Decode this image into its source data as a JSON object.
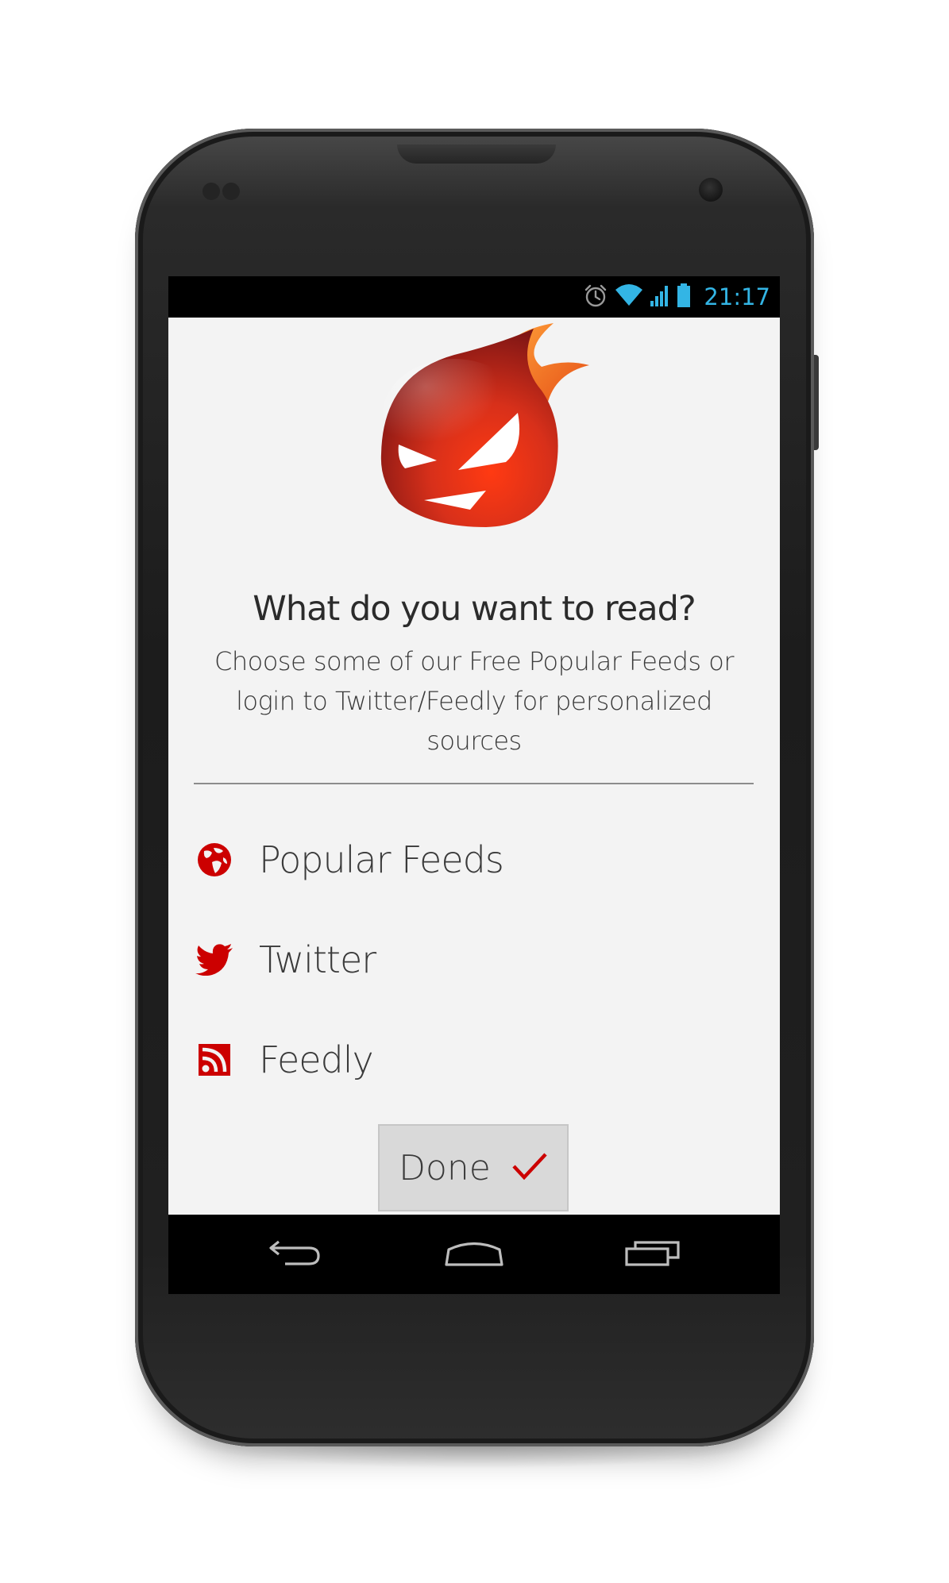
{
  "status_bar": {
    "time": "21:17",
    "icons": [
      "alarm-icon",
      "wifi-icon",
      "signal-icon",
      "battery-icon"
    ],
    "accent_color": "#33b5e5"
  },
  "app": {
    "logo": "devil-flame-logo",
    "title": "What do you want to read?",
    "subtitle": "Choose some of our Free Popular Feeds or login to Twitter/Feedly for personalized sources",
    "accent_color": "#cc0000",
    "options": [
      {
        "label": "Popular Feeds",
        "icon": "globe-icon"
      },
      {
        "label": "Twitter",
        "icon": "twitter-bird-icon"
      },
      {
        "label": "Feedly",
        "icon": "rss-icon"
      }
    ],
    "done_button": {
      "label": "Done",
      "icon": "checkmark-icon"
    }
  },
  "nav_bar": {
    "buttons": [
      "back-icon",
      "home-icon",
      "recent-apps-icon"
    ]
  }
}
